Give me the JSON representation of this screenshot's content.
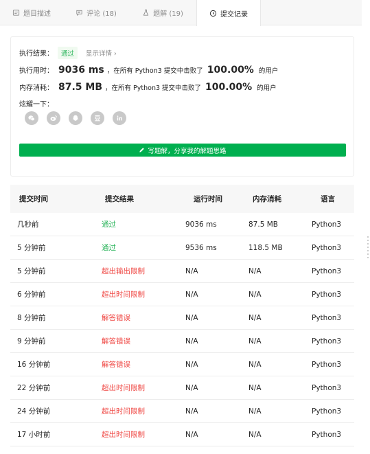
{
  "tabs": [
    {
      "label": "题目描述",
      "icon": "document-icon"
    },
    {
      "label": "评论 (18)",
      "icon": "comment-icon"
    },
    {
      "label": "题解 (19)",
      "icon": "flask-icon"
    },
    {
      "label": "提交记录",
      "icon": "clock-icon",
      "active": true
    }
  ],
  "result": {
    "status_label": "执行结果：",
    "status": "通过",
    "detail_link": "显示详情 ›",
    "runtime_label": "执行用时：",
    "runtime_value": "9036 ms",
    "runtime_text": "，在所有 Python3 提交中击败了",
    "runtime_percent": "100.00%",
    "runtime_suffix": "的用户",
    "memory_label": "内存消耗：",
    "memory_value": "87.5 MB",
    "memory_text": "，在所有 Python3 提交中击败了",
    "memory_percent": "100.00%",
    "memory_suffix": "的用户",
    "share_label": "炫耀一下：",
    "share_icons": [
      "wechat-icon",
      "weibo-icon",
      "qq-icon",
      "douban-icon",
      "linkedin-icon"
    ],
    "solution_button": "写题解，分享我的解题思路"
  },
  "submissions": {
    "headers": [
      "提交时间",
      "提交结果",
      "运行时间",
      "内存消耗",
      "语言"
    ],
    "rows": [
      {
        "time": "几秒前",
        "result": "通过",
        "ok": true,
        "runtime": "9036 ms",
        "memory": "87.5 MB",
        "lang": "Python3"
      },
      {
        "time": "5 分钟前",
        "result": "通过",
        "ok": true,
        "runtime": "9536 ms",
        "memory": "118.5 MB",
        "lang": "Python3"
      },
      {
        "time": "5 分钟前",
        "result": "超出输出限制",
        "ok": false,
        "runtime": "N/A",
        "memory": "N/A",
        "lang": "Python3"
      },
      {
        "time": "6 分钟前",
        "result": "超出时间限制",
        "ok": false,
        "runtime": "N/A",
        "memory": "N/A",
        "lang": "Python3"
      },
      {
        "time": "8 分钟前",
        "result": "解答错误",
        "ok": false,
        "runtime": "N/A",
        "memory": "N/A",
        "lang": "Python3"
      },
      {
        "time": "9 分钟前",
        "result": "解答错误",
        "ok": false,
        "runtime": "N/A",
        "memory": "N/A",
        "lang": "Python3"
      },
      {
        "time": "16 分钟前",
        "result": "解答错误",
        "ok": false,
        "runtime": "N/A",
        "memory": "N/A",
        "lang": "Python3"
      },
      {
        "time": "22 分钟前",
        "result": "超出时间限制",
        "ok": false,
        "runtime": "N/A",
        "memory": "N/A",
        "lang": "Python3"
      },
      {
        "time": "24 分钟前",
        "result": "超出时间限制",
        "ok": false,
        "runtime": "N/A",
        "memory": "N/A",
        "lang": "Python3"
      },
      {
        "time": "17 小时前",
        "result": "超出时间限制",
        "ok": false,
        "runtime": "N/A",
        "memory": "N/A",
        "lang": "Python3"
      }
    ]
  },
  "colors": {
    "accent_green": "#00af4f",
    "pass_green": "#2db55d",
    "fail_red": "#ef4743"
  }
}
